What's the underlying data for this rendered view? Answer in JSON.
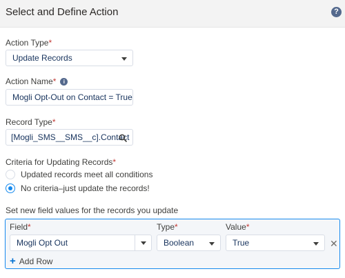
{
  "header": {
    "title": "Select and Define Action",
    "help_icon": "help-icon",
    "help_glyph": "?"
  },
  "action_type": {
    "label": "Action Type",
    "required_mark": "*",
    "value": "Update Records"
  },
  "action_name": {
    "label": "Action Name",
    "required_mark": "*",
    "info_icon": "info-icon",
    "info_glyph": "i",
    "value": "Mogli Opt-Out on Contact = True"
  },
  "record_type": {
    "label": "Record Type",
    "required_mark": "*",
    "value": "[Mogli_SMS__SMS__c].Contact",
    "icon": "search-icon"
  },
  "criteria": {
    "label": "Criteria for Updating Records",
    "required_mark": "*",
    "options": [
      {
        "label": "Updated records meet all conditions",
        "checked": false
      },
      {
        "label": "No criteria–just update the records!",
        "checked": true
      }
    ]
  },
  "field_values": {
    "section_label": "Set new field values for the records you update",
    "columns": {
      "field": "Field",
      "type": "Type",
      "value": "Value",
      "required_mark": "*"
    },
    "rows": [
      {
        "field": "Mogli Opt Out",
        "type": "Boolean",
        "value": "True"
      }
    ],
    "remove_glyph": "✕",
    "add_row_glyph": "+",
    "add_row_label": "Add Row"
  },
  "colors": {
    "accent": "#1589ee",
    "required": "#c23934",
    "text": "#3e3e3c"
  }
}
